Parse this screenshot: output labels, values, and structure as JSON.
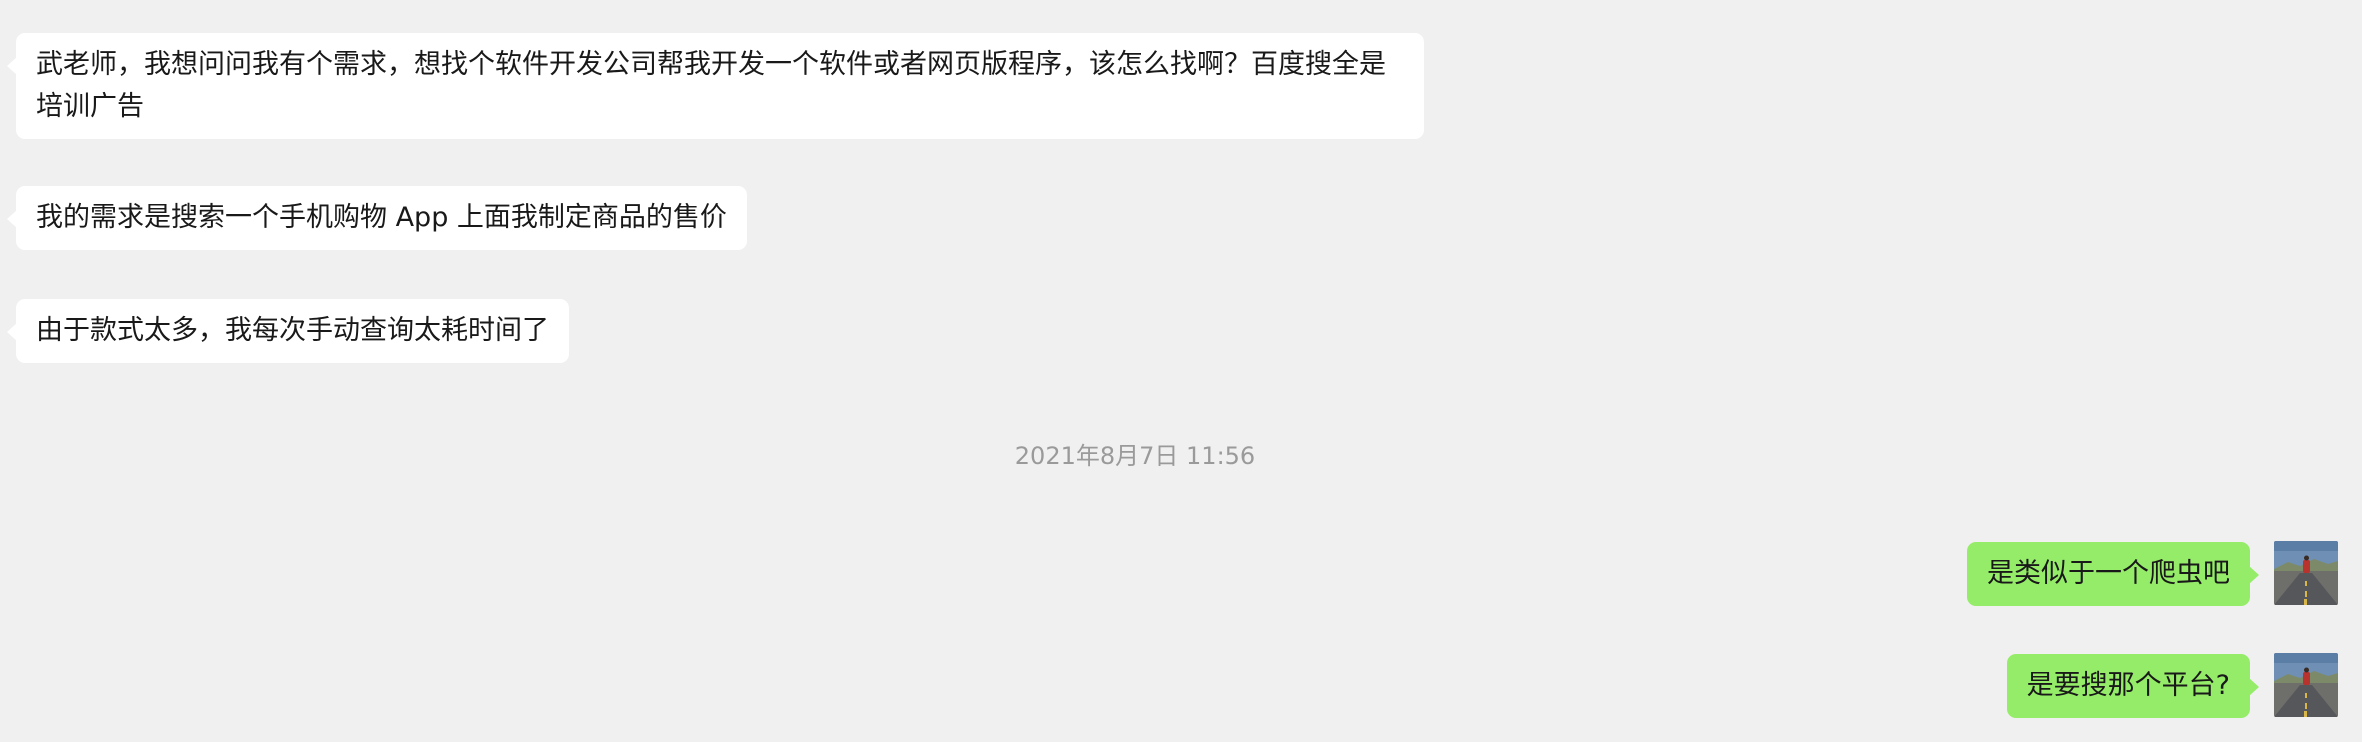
{
  "messages": [
    {
      "side": "left",
      "text": "武老师，我想问问我有个需求，想找个软件开发公司帮我开发一个软件或者网页版程序，该怎么找啊？百度搜全是培训广告"
    },
    {
      "side": "left",
      "text": "我的需求是搜索一个手机购物 App 上面我制定商品的售价"
    },
    {
      "side": "left",
      "text": "由于款式太多，我每次手动查询太耗时间了"
    },
    {
      "side": "right",
      "text": "是类似于一个爬虫吧"
    },
    {
      "side": "right",
      "text": "是要搜那个平台?"
    }
  ],
  "timestamp": "2021年8月7日 11:56",
  "colors": {
    "background": "#f0f0f0",
    "incoming_bubble": "#ffffff",
    "outgoing_bubble": "#95ec69",
    "timestamp_text": "#9a9a9a"
  }
}
